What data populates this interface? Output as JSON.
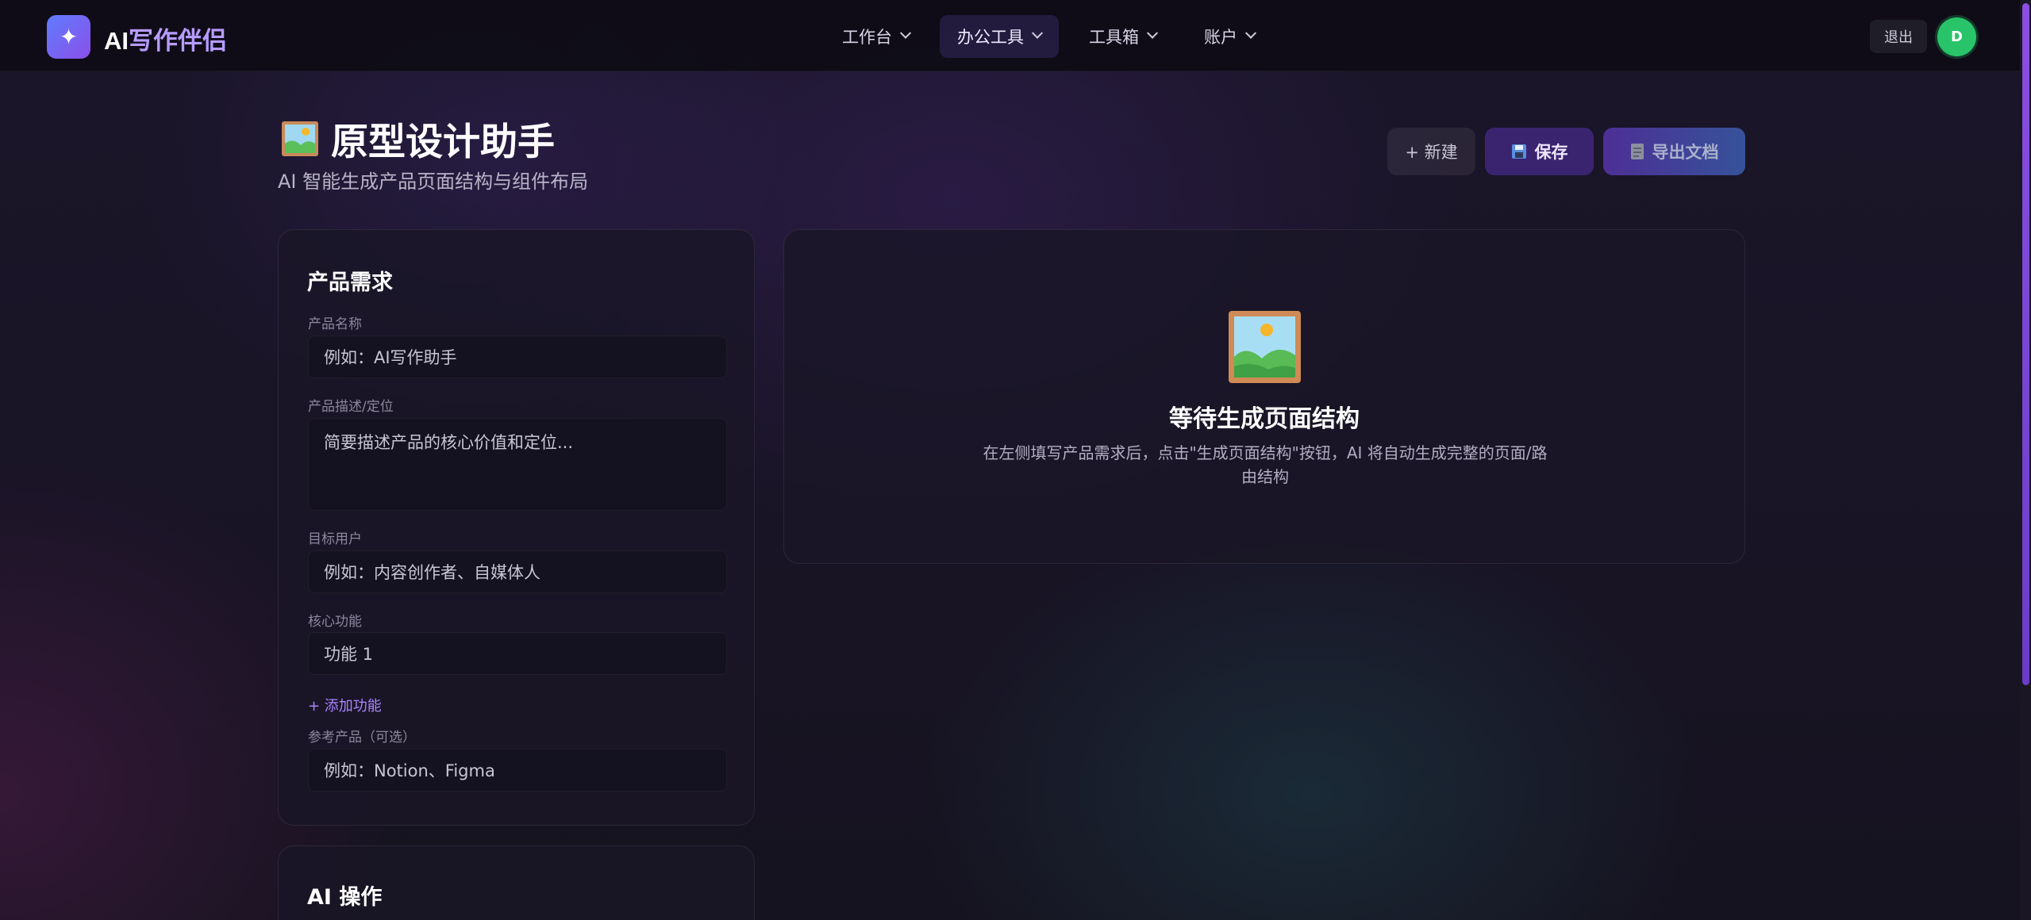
{
  "header": {
    "logo_glyph": "✦",
    "brand_ai": "AI",
    "brand_rest": "写作伴侣",
    "nav": [
      {
        "label": "工作台"
      },
      {
        "label": "办公工具"
      },
      {
        "label": "工具箱"
      },
      {
        "label": "账户"
      }
    ],
    "logout": "退出",
    "avatar_initial": "D"
  },
  "page": {
    "title": "原型设计助手",
    "subtitle": "AI 智能生成产品页面结构与组件布局",
    "buttons": {
      "new": "+ 新建",
      "save": "保存",
      "export": "导出文档"
    }
  },
  "form": {
    "title": "产品需求",
    "product_name": {
      "label": "产品名称",
      "placeholder": "例如：AI写作助手"
    },
    "description": {
      "label": "产品描述/定位",
      "placeholder": "简要描述产品的核心价值和定位..."
    },
    "target_users": {
      "label": "目标用户",
      "placeholder": "例如：内容创作者、自媒体人"
    },
    "core_features": {
      "label": "核心功能",
      "items": [
        {
          "placeholder": "功能 1"
        }
      ],
      "add_label": "+ 添加功能"
    },
    "reference": {
      "label": "参考产品（可选）",
      "placeholder": "例如：Notion、Figma"
    }
  },
  "ai_section": {
    "title": "AI 操作"
  },
  "result": {
    "empty_title": "等待生成页面结构",
    "empty_desc": "在左侧填写产品需求后，点击\"生成页面结构\"按钮，AI 将自动生成完整的页面/路由结构"
  },
  "colors": {
    "accent": "#8b4fe8",
    "link": "#a985ff",
    "avatar": "#29c46a",
    "background": "#16121f"
  }
}
